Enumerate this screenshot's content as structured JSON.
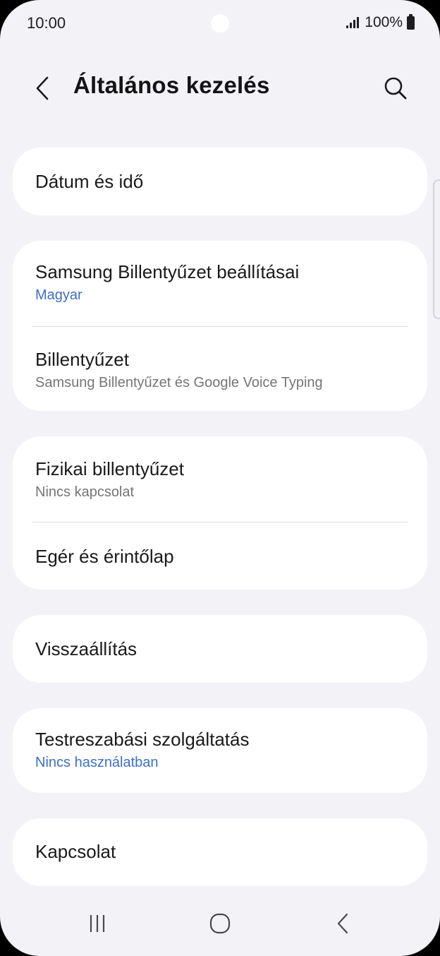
{
  "status_bar": {
    "time": "10:00",
    "battery": "100%"
  },
  "header": {
    "title": "Általános kezelés",
    "back_icon": "chevron-left-icon",
    "search_icon": "search-icon"
  },
  "cards": [
    {
      "items": [
        {
          "title": "Dátum és idő"
        }
      ]
    },
    {
      "items": [
        {
          "title": "Samsung Billentyűzet beállításai",
          "subtitle": "Magyar"
        },
        {
          "title": "Billentyűzet",
          "subtitle": "Samsung Billentyűzet és Google Voice Typing"
        }
      ]
    },
    {
      "items": [
        {
          "title": "Fizikai billentyűzet",
          "subtitle": "Nincs kapcsolat"
        },
        {
          "title": "Egér és érintőlap"
        }
      ]
    },
    {
      "items": [
        {
          "title": "Visszaállítás"
        }
      ]
    },
    {
      "items": [
        {
          "title": "Testreszabási szolgáltatás",
          "subtitle": "Nincs használatban"
        }
      ]
    },
    {
      "items": [
        {
          "title": "Kapcsolat"
        }
      ]
    }
  ],
  "nav_bar": {
    "recents_icon": "recents-icon",
    "home_icon": "home-icon",
    "back_icon": "back-icon"
  },
  "colors": {
    "background": "#f3f2f7",
    "card": "#ffffff",
    "accent_text": "#3e6fc8",
    "secondary_text": "#757575"
  }
}
